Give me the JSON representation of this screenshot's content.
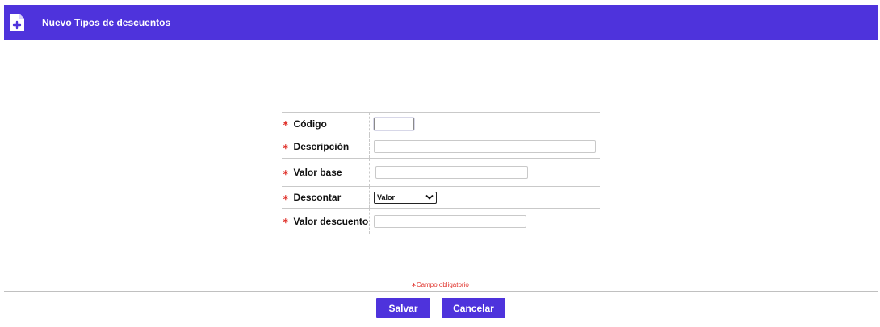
{
  "header": {
    "title": "Nuevo Tipos de descuentos",
    "icon": "document-add-icon",
    "color": "#4e33dc"
  },
  "form": {
    "fields": [
      {
        "label": "Código",
        "value": "",
        "required": true
      },
      {
        "label": "Descripción",
        "value": "",
        "required": true
      },
      {
        "label": "Valor base",
        "value": "",
        "required": true
      },
      {
        "label": "Descontar",
        "selected": "Valor",
        "required": true
      },
      {
        "label": "Valor descuento",
        "value": "",
        "required": true
      }
    ],
    "required_mark": "∗"
  },
  "footer": {
    "required_note": "∗Campo obligatorio",
    "save_label": "Salvar",
    "cancel_label": "Cancelar"
  }
}
